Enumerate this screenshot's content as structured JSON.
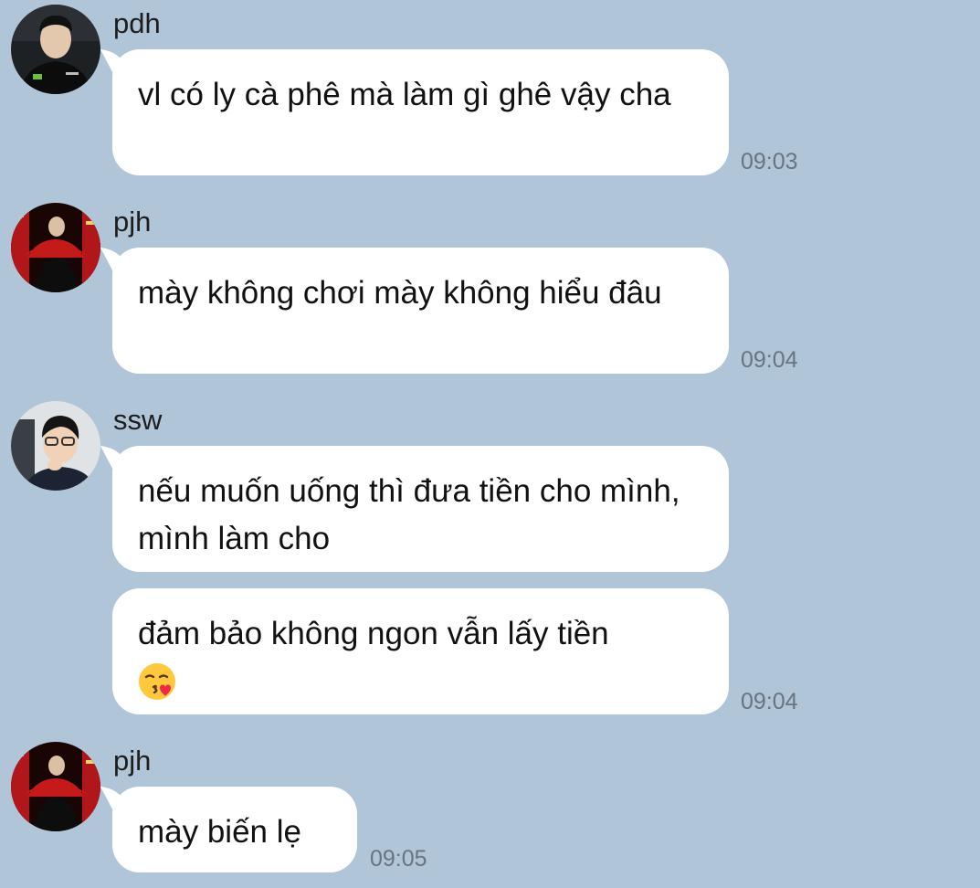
{
  "messages": [
    {
      "sender": "pdh",
      "avatar": "pdh-avatar",
      "bubbles": [
        "vl có ly cà phê mà làm gì ghê vậy cha"
      ],
      "time": "09:03"
    },
    {
      "sender": "pjh",
      "avatar": "pjh-avatar",
      "bubbles": [
        "mày không chơi mày không hiểu đâu"
      ],
      "time": "09:04"
    },
    {
      "sender": "ssw",
      "avatar": "ssw-avatar",
      "bubbles": [
        "nếu muốn uống thì đưa tiền cho mình, mình làm cho",
        "đảm bảo không ngon vẫn lấy tiền"
      ],
      "emoji": "face-blowing-a-kiss-icon",
      "time": "09:04"
    },
    {
      "sender": "pjh",
      "avatar": "pjh-avatar",
      "bubbles": [
        "mày biến lẹ"
      ],
      "time": "09:05"
    }
  ],
  "colors": {
    "background": "#b1c5d9",
    "bubble": "#ffffff",
    "timestamp": "#687480"
  }
}
